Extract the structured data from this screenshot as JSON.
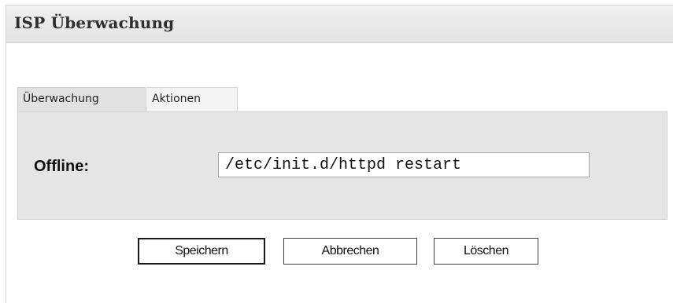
{
  "panel": {
    "title": "ISP Überwachung"
  },
  "tabs": [
    {
      "label": "Überwachung",
      "active": true
    },
    {
      "label": "Aktionen",
      "active": false
    }
  ],
  "form": {
    "offline_label": "Offline:",
    "offline_value": "/etc/init.d/httpd restart"
  },
  "buttons": {
    "save": "Speichern",
    "cancel": "Abbrechen",
    "delete": "Löschen"
  }
}
